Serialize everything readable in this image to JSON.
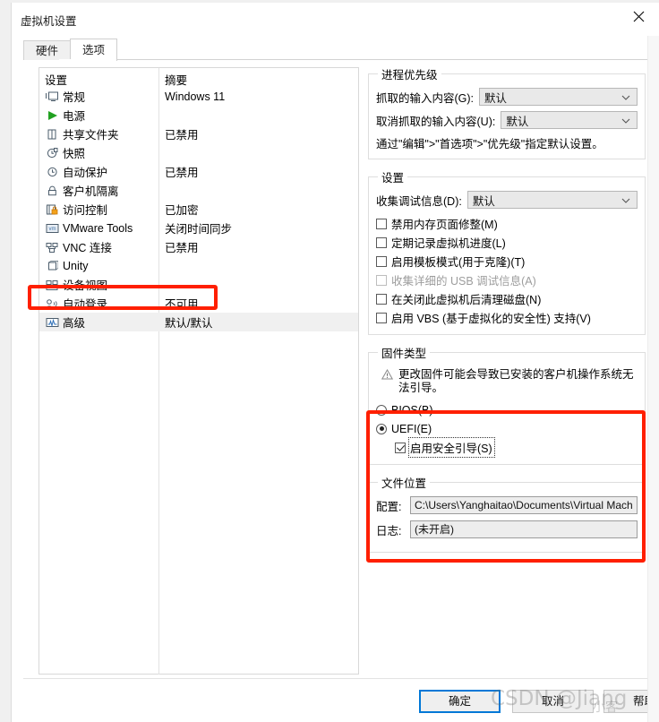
{
  "window": {
    "title": "虚拟机设置",
    "close_label": "✕"
  },
  "tabs": [
    {
      "label": "硬件",
      "selected": false
    },
    {
      "label": "选项",
      "selected": true
    }
  ],
  "settings_list": {
    "col_setting": "设置",
    "col_summary": "摘要",
    "rows": [
      {
        "icon": "monitor-icon",
        "label": "常规",
        "summary": "Windows 11"
      },
      {
        "icon": "play-icon",
        "label": "电源",
        "summary": ""
      },
      {
        "icon": "folder-icon",
        "label": "共享文件夹",
        "summary": "已禁用"
      },
      {
        "icon": "clock-snapshot-icon",
        "label": "快照",
        "summary": ""
      },
      {
        "icon": "history-icon",
        "label": "自动保护",
        "summary": "已禁用"
      },
      {
        "icon": "lock-icon",
        "label": "客户机隔离",
        "summary": ""
      },
      {
        "icon": "access-control-icon",
        "label": "访问控制",
        "summary": "已加密"
      },
      {
        "icon": "vmware-tools-icon",
        "label": "VMware Tools",
        "summary": "关闭时间同步"
      },
      {
        "icon": "vnc-icon",
        "label": "VNC 连接",
        "summary": "已禁用"
      },
      {
        "icon": "unity-icon",
        "label": "Unity",
        "summary": ""
      },
      {
        "icon": "device-view-icon",
        "label": "设备视图",
        "summary": ""
      },
      {
        "icon": "auto-login-icon",
        "label": "自动登录",
        "summary": "不可用"
      },
      {
        "icon": "advanced-icon",
        "label": "高级",
        "summary": "默认/默认",
        "selected": true
      }
    ]
  },
  "process_priority": {
    "legend": "进程优先级",
    "grab_label": "抓取的输入内容(G):",
    "grab_value": "默认",
    "ungrab_label": "取消抓取的输入内容(U):",
    "ungrab_value": "默认",
    "hint": "通过\"编辑\">\"首选项\">\"优先级\"指定默认设置。"
  },
  "settings_group": {
    "legend": "设置",
    "debug_label": "收集调试信息(D):",
    "debug_value": "默认",
    "checkboxes": [
      {
        "label": "禁用内存页面修整(M)",
        "checked": false,
        "disabled": false
      },
      {
        "label": "定期记录虚拟机进度(L)",
        "checked": false,
        "disabled": false
      },
      {
        "label": "启用模板模式(用于克隆)(T)",
        "checked": false,
        "disabled": false
      },
      {
        "label": "收集详细的 USB 调试信息(A)",
        "checked": false,
        "disabled": true
      },
      {
        "label": "在关闭此虚拟机后清理磁盘(N)",
        "checked": false,
        "disabled": false
      },
      {
        "label": "启用 VBS (基于虚拟化的安全性) 支持(V)",
        "checked": false,
        "disabled": false
      }
    ]
  },
  "firmware": {
    "legend": "固件类型",
    "warning": "更改固件可能会导致已安装的客户机操作系统无法引导。",
    "bios_label": "BIOS(B)",
    "bios_selected": false,
    "uefi_label": "UEFI(E)",
    "uefi_selected": true,
    "secureboot_label": "启用安全引导(S)",
    "secureboot_checked": true
  },
  "file_location": {
    "legend": "文件位置",
    "config_label": "配置:",
    "config_value": "C:\\Users\\Yanghaitao\\Documents\\Virtual Mach",
    "log_label": "日志:",
    "log_value": "(未开启)"
  },
  "footer": {
    "ok": "确定",
    "cancel": "取消",
    "help": "帮助"
  },
  "watermark": {
    "text": "CSDN @Jiang",
    "text2": "小客"
  },
  "colors": {
    "annotation_red": "#ff1f00",
    "primary_button_border": "#0078d7",
    "selected_row": "#f0f0f0"
  }
}
